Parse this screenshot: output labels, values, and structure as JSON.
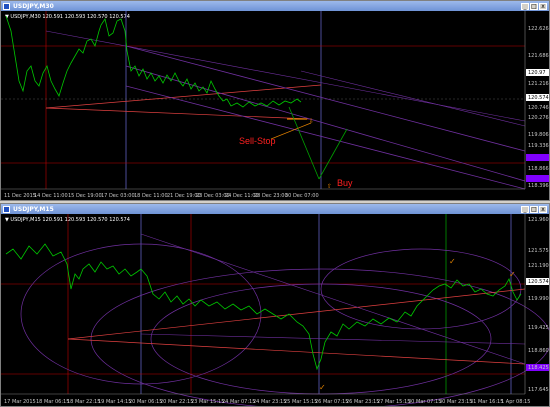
{
  "top": {
    "title": "USDJPY,M30",
    "ohlc_header": "▼ USDJPY,M30  120.591 120.593 120.570 120.574",
    "price_labels": [
      "120.574",
      "122.626",
      "121.686",
      "121.216",
      "120.746",
      "120.276",
      "119.806",
      "119.336",
      "118.866",
      "118.396"
    ],
    "flag_label": "120.97",
    "time_labels": [
      "11 Dec 2015",
      "14 Dec 11:00",
      "15 Dec 19:00",
      "17 Dec 03:00",
      "18 Dec 11:00",
      "21 Dec 19:00",
      "23 Dec 03:00",
      "24 Dec 11:00",
      "28 Dec 23:00",
      "30 Dec 07:00"
    ],
    "annotation_sell": "Sell-Stop",
    "annotation_buy": "Buy"
  },
  "bottom": {
    "title": "USDJPY,M15",
    "ohlc_header": "▼ USDJPY,M15  120.591 120.593 120.570 120.574",
    "price_labels": [
      "121.960",
      "121.575",
      "121.190",
      "120.574",
      "119.990",
      "119.425",
      "118.860",
      "118.425",
      "117.645"
    ],
    "time_labels": [
      "17 Mar 2015",
      "18 Mar 06:15",
      "18 Mar 22:15",
      "19 Mar 14:15",
      "20 Mar 06:15",
      "20 Mar 22:15",
      "23 Mar 15:15",
      "24 Mar 07:15",
      "24 Mar 23:15",
      "25 Mar 15:15",
      "26 Mar 07:15",
      "26 Mar 23:15",
      "27 Mar 15:15",
      "30 Mar 07:15",
      "30 Mar 23:15",
      "31 Mar 16:15",
      "1 Apr 08:15"
    ]
  },
  "colors": {
    "price_line": "#00c800",
    "purple": "#7030a0",
    "red": "#c00000",
    "ann_red": "#ff2020"
  }
}
